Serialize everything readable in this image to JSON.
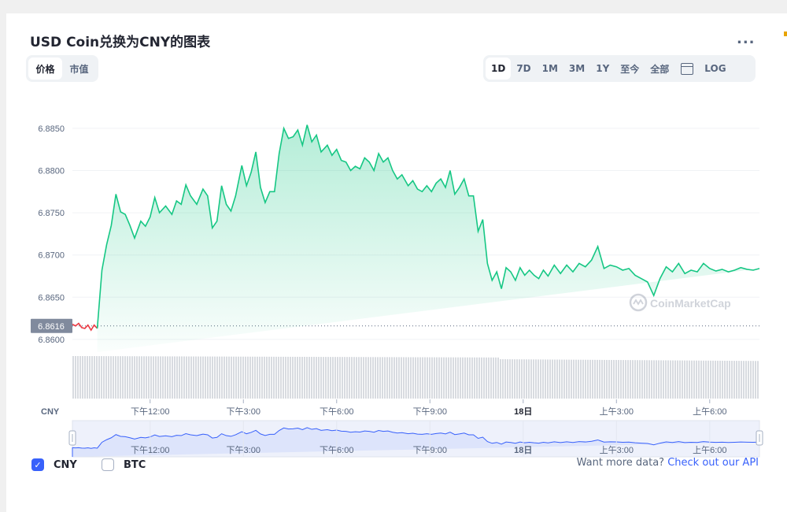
{
  "title": "USD Coin兑换为CNY的图表",
  "more_label": "...",
  "view_tabs": [
    {
      "label": "价格",
      "active": true
    },
    {
      "label": "市值",
      "active": false
    }
  ],
  "range_tabs": [
    {
      "label": "1D",
      "active": true
    },
    {
      "label": "7D",
      "active": false
    },
    {
      "label": "1M",
      "active": false
    },
    {
      "label": "3M",
      "active": false
    },
    {
      "label": "1Y",
      "active": false
    },
    {
      "label": "至今",
      "active": false
    },
    {
      "label": "全部",
      "active": false
    }
  ],
  "log_label": "LOG",
  "colors": {
    "up": "#16c784",
    "down": "#ea3943",
    "accent": "#3861fb",
    "volume": "#d8dbe0"
  },
  "chart_data": {
    "type": "area",
    "y_ticks": [
      "6.8850",
      "6.8800",
      "6.8750",
      "6.8700",
      "6.8650",
      "6.8600"
    ],
    "ylim": [
      6.8585,
      6.8862
    ],
    "current_value": 6.8616,
    "current_label": "6.8616",
    "ylabel": "CNY",
    "x_ticks": [
      {
        "label": "下午12:00",
        "bold": false
      },
      {
        "label": "下午3:00",
        "bold": false
      },
      {
        "label": "下午6:00",
        "bold": false
      },
      {
        "label": "下午9:00",
        "bold": false
      },
      {
        "label": "18日",
        "bold": true
      },
      {
        "label": "上午3:00",
        "bold": false
      },
      {
        "label": "上午6:00",
        "bold": false
      }
    ],
    "tick_hours": [
      12,
      15,
      18,
      21,
      24,
      27,
      30
    ],
    "x_hours": [
      9.5,
      9.6,
      9.7,
      9.8,
      9.9,
      10,
      10.1,
      10.2,
      10.3,
      10.45,
      10.6,
      10.75,
      10.9,
      11.05,
      11.2,
      11.35,
      11.5,
      11.7,
      11.85,
      12,
      12.15,
      12.3,
      12.5,
      12.7,
      12.85,
      13,
      13.15,
      13.3,
      13.5,
      13.7,
      13.85,
      14,
      14.15,
      14.3,
      14.45,
      14.6,
      14.75,
      14.95,
      15.1,
      15.25,
      15.4,
      15.55,
      15.7,
      15.85,
      16,
      16.15,
      16.3,
      16.45,
      16.6,
      16.75,
      16.9,
      17.05,
      17.2,
      17.35,
      17.5,
      17.7,
      17.85,
      18,
      18.15,
      18.3,
      18.45,
      18.6,
      18.75,
      18.9,
      19.05,
      19.2,
      19.35,
      19.5,
      19.65,
      19.8,
      19.95,
      20.1,
      20.3,
      20.45,
      20.6,
      20.75,
      20.9,
      21.05,
      21.2,
      21.35,
      21.5,
      21.65,
      21.8,
      21.95,
      22.1,
      22.25,
      22.4,
      22.55,
      22.7,
      22.85,
      23,
      23.15,
      23.3,
      23.45,
      23.6,
      23.75,
      23.9,
      24.05,
      24.2,
      24.35,
      24.5,
      24.65,
      24.8,
      25,
      25.2,
      25.4,
      25.6,
      25.8,
      26,
      26.2,
      26.4,
      26.6,
      26.8,
      27,
      27.2,
      27.4,
      27.6,
      27.8,
      28,
      28.2,
      28.4,
      28.6,
      28.8,
      29,
      29.2,
      29.4,
      29.6,
      29.8,
      30,
      30.2,
      30.4,
      30.6,
      30.8,
      31,
      31.2,
      31.4,
      31.6
    ],
    "values": [
      6.8618,
      6.8616,
      6.8619,
      6.8614,
      6.8613,
      6.8617,
      6.8611,
      6.8617,
      6.8613,
      6.8682,
      6.8712,
      6.8735,
      6.8772,
      6.8751,
      6.8748,
      6.8735,
      6.872,
      6.874,
      6.8734,
      6.8745,
      6.8768,
      6.875,
      6.8758,
      6.8748,
      6.8764,
      6.876,
      6.8783,
      6.877,
      6.876,
      6.8778,
      6.877,
      6.8732,
      6.874,
      6.8782,
      6.876,
      6.8752,
      6.877,
      6.8806,
      6.8782,
      6.8798,
      6.8822,
      6.878,
      6.8762,
      6.8775,
      6.8775,
      6.882,
      6.885,
      6.8838,
      6.884,
      6.8848,
      6.883,
      6.8854,
      6.8834,
      6.8842,
      6.8822,
      6.883,
      6.8818,
      6.8825,
      6.8812,
      6.881,
      6.88,
      6.8805,
      6.8802,
      6.8815,
      6.881,
      6.88,
      6.882,
      6.881,
      6.8815,
      6.88,
      6.879,
      6.8795,
      6.8782,
      6.8788,
      6.8778,
      6.8775,
      6.8782,
      6.8775,
      6.8785,
      6.879,
      6.878,
      6.88,
      6.8772,
      6.878,
      6.879,
      6.877,
      6.877,
      6.8728,
      6.8742,
      6.869,
      6.867,
      6.868,
      6.866,
      6.8685,
      6.868,
      6.867,
      6.8685,
      6.8676,
      6.8682,
      6.8676,
      6.8672,
      6.8682,
      6.8675,
      6.8688,
      6.8678,
      6.8688,
      6.868,
      6.869,
      6.8686,
      6.8694,
      6.871,
      6.8684,
      6.8688,
      6.8686,
      6.8682,
      6.8684,
      6.8676,
      6.8672,
      6.8668,
      6.8652,
      6.8672,
      6.8686,
      6.868,
      6.869,
      6.8678,
      6.8682,
      6.868,
      6.869,
      6.8684,
      6.8681,
      6.8683,
      6.868,
      6.8682,
      6.8685,
      6.8683,
      6.8682,
      6.8684,
      6.869,
      6.8686
    ]
  },
  "navigator_ticks": [
    "下午12:00",
    "下午3:00",
    "下午6:00",
    "下午9:00",
    "18日",
    "上午3:00",
    "上午6:00"
  ],
  "watermark": "CoinMarketCap",
  "legend": [
    {
      "label": "CNY",
      "checked": true,
      "check_glyph": "✓"
    },
    {
      "label": "BTC",
      "checked": false
    }
  ],
  "api": {
    "text": "Want more data?",
    "link": "Check out our API"
  }
}
